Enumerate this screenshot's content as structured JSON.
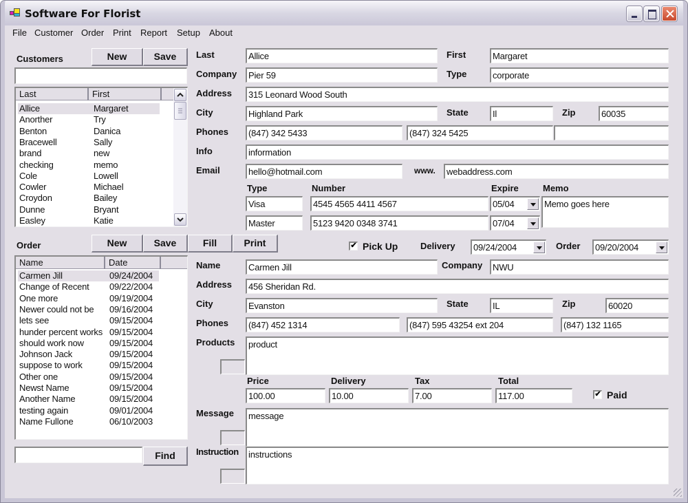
{
  "window": {
    "title": "Software For Florist",
    "controls": {
      "minimize": "minimize",
      "maximize": "maximize",
      "close": "close"
    }
  },
  "menu": [
    "File",
    "Customer",
    "Order",
    "Print",
    "Report",
    "Setup",
    "About"
  ],
  "customers": {
    "heading": "Customers",
    "new_label": "New",
    "save_label": "Save",
    "search_value": "",
    "columns": [
      "Last",
      "First"
    ],
    "rows": [
      {
        "last": "Allice",
        "first": "Margaret",
        "selected": true
      },
      {
        "last": "Anorther",
        "first": "Try"
      },
      {
        "last": "Benton",
        "first": "Danica"
      },
      {
        "last": "Bracewell",
        "first": "Sally"
      },
      {
        "last": "brand",
        "first": "new"
      },
      {
        "last": "checking",
        "first": "memo"
      },
      {
        "last": "Cole",
        "first": "Lowell"
      },
      {
        "last": "Cowler",
        "first": "Michael"
      },
      {
        "last": "Croydon",
        "first": "Bailey"
      },
      {
        "last": "Dunne",
        "first": "Bryant"
      },
      {
        "last": "Easley",
        "first": "Katie"
      }
    ]
  },
  "customer_form": {
    "last_label": "Last",
    "last": "Allice",
    "first_label": "First",
    "first": "Margaret",
    "company_label": "Company",
    "company": "Pier 59",
    "type_label": "Type",
    "type": "corporate",
    "address_label": "Address",
    "address": "315 Leonard Wood South",
    "city_label": "City",
    "city": "Highland Park",
    "state_label": "State",
    "state": "Il",
    "zip_label": "Zip",
    "zip": "60035",
    "phones_label": "Phones",
    "phone1": "(847) 342 5433",
    "phone2": "(847) 324 5425",
    "phone3": "",
    "info_label": "Info",
    "info": "information",
    "email_label": "Email",
    "email": "hello@hotmail.com",
    "www_label": "www.",
    "www": "webaddress.com",
    "cards": {
      "type_label": "Type",
      "number_label": "Number",
      "expire_label": "Expire",
      "memo_label": "Memo",
      "rows": [
        {
          "type": "Visa",
          "number": "4545 4565 4411 4567",
          "expire": "05/04"
        },
        {
          "type": "Master",
          "number": "5123 9420 0348 3741",
          "expire": "07/04"
        }
      ],
      "memo": "Memo goes here"
    }
  },
  "orders": {
    "heading": "Order",
    "new_label": "New",
    "save_label": "Save",
    "fill_label": "Fill",
    "print_label": "Print",
    "columns": [
      "Name",
      "Date"
    ],
    "rows": [
      {
        "name": "Carmen Jill",
        "date": "09/24/2004",
        "selected": true
      },
      {
        "name": "Change of Recent",
        "date": "09/22/2004"
      },
      {
        "name": "One more",
        "date": "09/19/2004"
      },
      {
        "name": "Newer could not be",
        "date": "09/16/2004"
      },
      {
        "name": "lets see",
        "date": "09/15/2004"
      },
      {
        "name": "hunder percent works",
        "date": "09/15/2004"
      },
      {
        "name": "should work now",
        "date": "09/15/2004"
      },
      {
        "name": "Johnson Jack",
        "date": "09/15/2004"
      },
      {
        "name": "suppose to work",
        "date": "09/15/2004"
      },
      {
        "name": "Other one",
        "date": "09/15/2004"
      },
      {
        "name": "Newst Name",
        "date": "09/15/2004"
      },
      {
        "name": "Another Name",
        "date": "09/15/2004"
      },
      {
        "name": "testing again",
        "date": "09/01/2004"
      },
      {
        "name": "Name Fullone",
        "date": "06/10/2003"
      }
    ],
    "find_value": "",
    "find_label": "Find"
  },
  "order_form": {
    "pickup_label": "Pick Up",
    "pickup_checked": true,
    "pickup_mark": "✔",
    "delivery_label": "Delivery",
    "delivery_date": "09/24/2004",
    "order_label": "Order",
    "order_date": "09/20/2004",
    "name_label": "Name",
    "name": "Carmen Jill",
    "company_label": "Company",
    "company": "NWU",
    "address_label": "Address",
    "address": "456 Sheridan Rd.",
    "city_label": "City",
    "city": "Evanston",
    "state_label": "State",
    "state": "IL",
    "zip_label": "Zip",
    "zip": "60020",
    "phones_label": "Phones",
    "phone1": "(847) 452 1314",
    "phone2": "(847) 595 43254 ext 204",
    "phone3": "(847) 132 1165",
    "products_label": "Products",
    "products": "product",
    "price_label": "Price",
    "price": "100.00",
    "delivery_fee_label": "Delivery",
    "delivery_fee": "10.00",
    "tax_label": "Tax",
    "tax": "7.00",
    "total_label": "Total",
    "total": "117.00",
    "paid_label": "Paid",
    "paid_checked": true,
    "paid_mark": "✔",
    "message_label": "Message",
    "message": "message",
    "instruction_label": "Instruction",
    "instruction": "instructions"
  }
}
